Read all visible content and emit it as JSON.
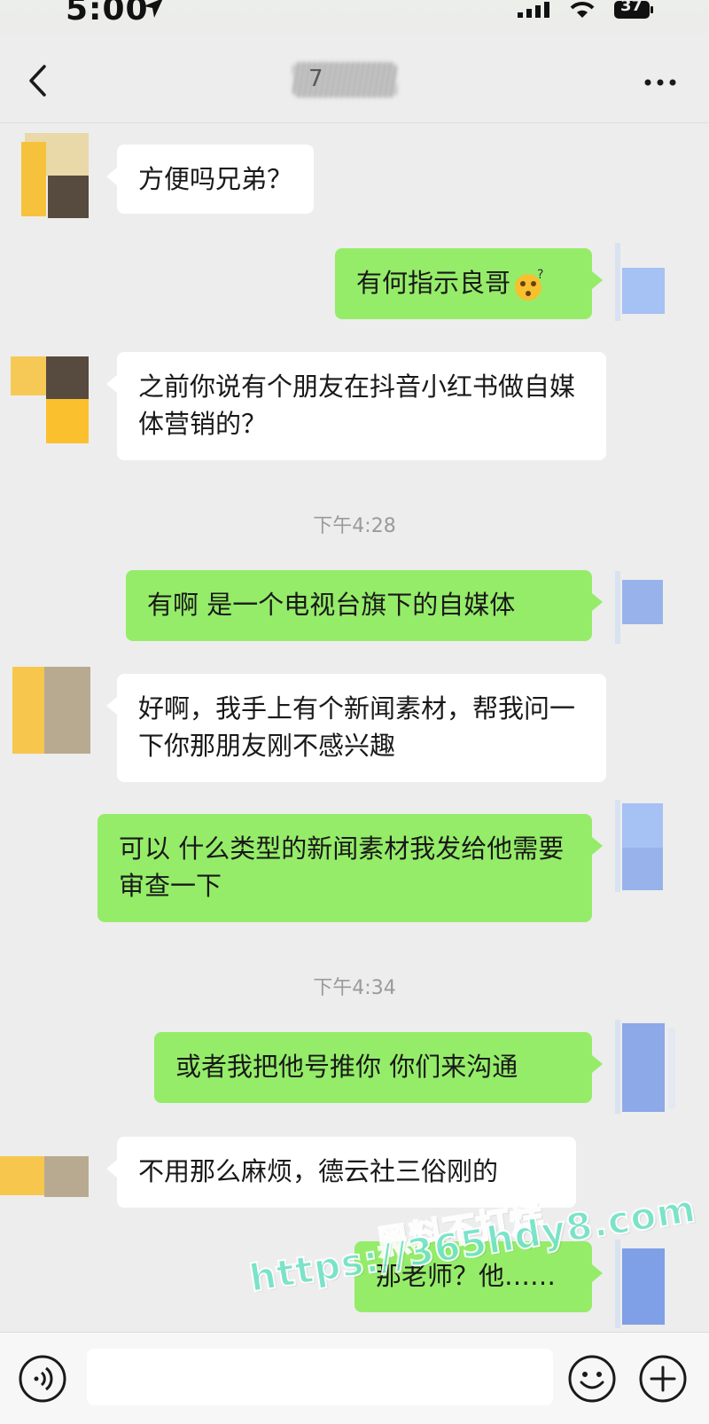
{
  "status_bar": {
    "time": "5:00",
    "battery": "37"
  },
  "header": {
    "title": "7",
    "more_label": "···"
  },
  "messages": [
    {
      "side": "in",
      "text": "方便吗兄弟？"
    },
    {
      "side": "out",
      "text": "有何指示良哥",
      "emoji": "thinking-face-emoji"
    },
    {
      "side": "in",
      "text": "之前你说有个朋友在抖音小红书做自媒体营销的？"
    },
    {
      "side": "out",
      "text": "有啊 是一个电视台旗下的自媒体"
    },
    {
      "side": "in",
      "text": "好啊，我手上有个新闻素材，帮我问一下你那朋友刚不感兴趣"
    },
    {
      "side": "out",
      "text": "可以 什么类型的新闻素材我发给他需要审查一下"
    },
    {
      "side": "out",
      "text": "或者我把他号推你 你们来沟通"
    },
    {
      "side": "in",
      "text": "不用那么麻烦，德云社三俗刚的"
    },
    {
      "side": "out",
      "text": "那老师？他……"
    }
  ],
  "timestamps": [
    "下午4:28",
    "下午4:34"
  ],
  "watermark": {
    "line1": "黑料不打烊",
    "line2": "https://365hdy8.com"
  },
  "input_bar": {
    "placeholder": ""
  },
  "colors": {
    "outgoing_bubble": "#95ec69",
    "incoming_bubble": "#ffffff",
    "background": "#ededed",
    "watermark": "#6fe3c4"
  },
  "icons": [
    "location-arrow-icon",
    "signal-icon",
    "wifi-icon",
    "battery-icon",
    "back-chevron-icon",
    "more-icon",
    "voice-icon",
    "emoji-icon",
    "plus-icon"
  ]
}
